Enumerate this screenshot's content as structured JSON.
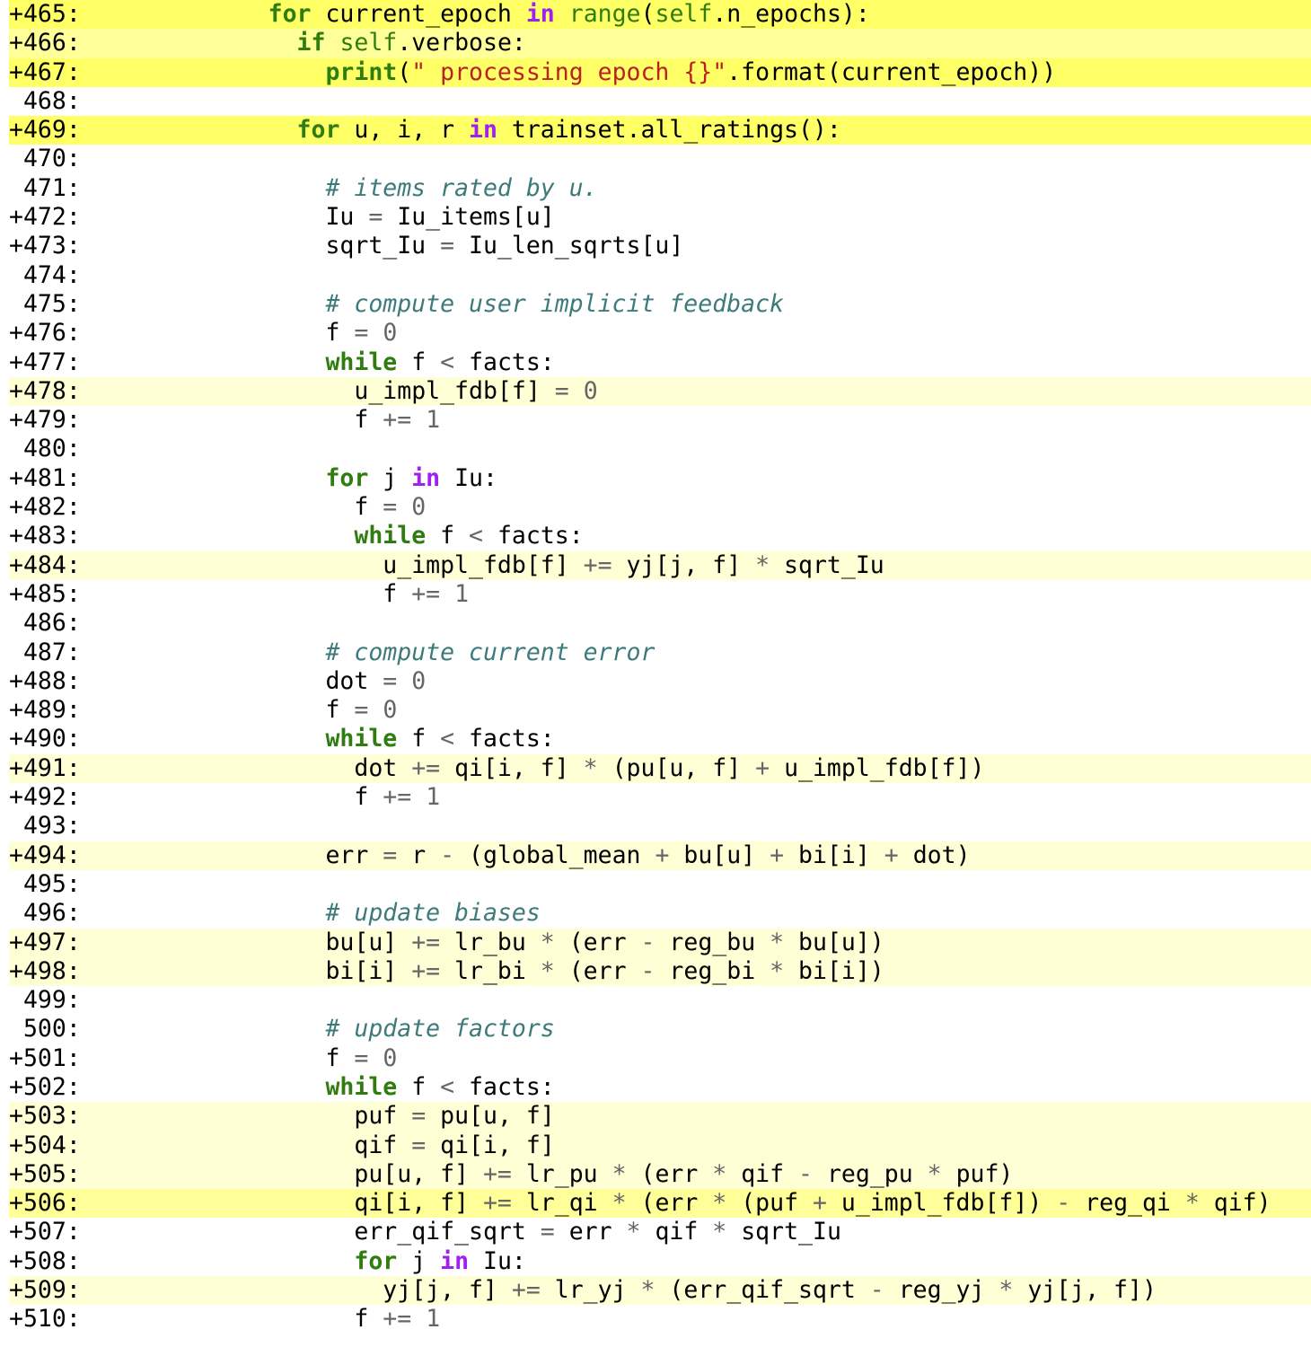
{
  "lines": [
    {
      "no": "+465:",
      "hl": 3,
      "indent": 4,
      "toks": [
        [
          "for",
          "kw"
        ],
        [
          " current_epoch ",
          ""
        ],
        [
          "in",
          "kwp"
        ],
        [
          " ",
          ""
        ],
        [
          "range",
          "bi"
        ],
        [
          "(",
          ""
        ],
        [
          "self",
          "bi"
        ],
        [
          ".n_epochs):",
          ""
        ]
      ]
    },
    {
      "no": "+466:",
      "hl": 2,
      "indent": 5,
      "toks": [
        [
          "if",
          "kw"
        ],
        [
          " ",
          ""
        ],
        [
          "self",
          "bi"
        ],
        [
          ".verbose:",
          ""
        ]
      ]
    },
    {
      "no": "+467:",
      "hl": 3,
      "indent": 6,
      "toks": [
        [
          "print",
          "kw"
        ],
        [
          "(",
          ""
        ],
        [
          "\" processing epoch {}\"",
          "str"
        ],
        [
          ".format(current_epoch))",
          ""
        ]
      ]
    },
    {
      "no": " 468:",
      "hl": 0,
      "indent": 0,
      "toks": []
    },
    {
      "no": "+469:",
      "hl": 3,
      "indent": 5,
      "toks": [
        [
          "for",
          "kw"
        ],
        [
          " u, i, r ",
          ""
        ],
        [
          "in",
          "kwp"
        ],
        [
          " trainset.all_ratings():",
          ""
        ]
      ]
    },
    {
      "no": " 470:",
      "hl": 0,
      "indent": 0,
      "toks": []
    },
    {
      "no": " 471:",
      "hl": 0,
      "indent": 6,
      "toks": [
        [
          "# items rated by u.",
          "cm"
        ]
      ]
    },
    {
      "no": "+472:",
      "hl": 0,
      "indent": 6,
      "toks": [
        [
          "Iu ",
          ""
        ],
        [
          "=",
          "op"
        ],
        [
          " Iu_items[u]",
          ""
        ]
      ]
    },
    {
      "no": "+473:",
      "hl": 0,
      "indent": 6,
      "toks": [
        [
          "sqrt_Iu ",
          ""
        ],
        [
          "=",
          "op"
        ],
        [
          " Iu_len_sqrts[u]",
          ""
        ]
      ]
    },
    {
      "no": " 474:",
      "hl": 0,
      "indent": 0,
      "toks": []
    },
    {
      "no": " 475:",
      "hl": 0,
      "indent": 6,
      "toks": [
        [
          "# compute user implicit feedback",
          "cm"
        ]
      ]
    },
    {
      "no": "+476:",
      "hl": 0,
      "indent": 6,
      "toks": [
        [
          "f ",
          ""
        ],
        [
          "=",
          "op"
        ],
        [
          " ",
          ""
        ],
        [
          "0",
          "num"
        ]
      ]
    },
    {
      "no": "+477:",
      "hl": 0,
      "indent": 6,
      "toks": [
        [
          "while",
          "kw"
        ],
        [
          " f ",
          ""
        ],
        [
          "<",
          "op"
        ],
        [
          " facts:",
          ""
        ]
      ]
    },
    {
      "no": "+478:",
      "hl": 1,
      "indent": 7,
      "toks": [
        [
          "u_impl_fdb[f] ",
          ""
        ],
        [
          "=",
          "op"
        ],
        [
          " ",
          ""
        ],
        [
          "0",
          "num"
        ]
      ]
    },
    {
      "no": "+479:",
      "hl": 0,
      "indent": 7,
      "toks": [
        [
          "f ",
          ""
        ],
        [
          "+=",
          "op"
        ],
        [
          " ",
          ""
        ],
        [
          "1",
          "num"
        ]
      ]
    },
    {
      "no": " 480:",
      "hl": 0,
      "indent": 0,
      "toks": []
    },
    {
      "no": "+481:",
      "hl": 0,
      "indent": 6,
      "toks": [
        [
          "for",
          "kw"
        ],
        [
          " j ",
          ""
        ],
        [
          "in",
          "kwp"
        ],
        [
          " Iu:",
          ""
        ]
      ]
    },
    {
      "no": "+482:",
      "hl": 0,
      "indent": 7,
      "toks": [
        [
          "f ",
          ""
        ],
        [
          "=",
          "op"
        ],
        [
          " ",
          ""
        ],
        [
          "0",
          "num"
        ]
      ]
    },
    {
      "no": "+483:",
      "hl": 0,
      "indent": 7,
      "toks": [
        [
          "while",
          "kw"
        ],
        [
          " f ",
          ""
        ],
        [
          "<",
          "op"
        ],
        [
          " facts:",
          ""
        ]
      ]
    },
    {
      "no": "+484:",
      "hl": 1,
      "indent": 8,
      "toks": [
        [
          "u_impl_fdb[f] ",
          ""
        ],
        [
          "+=",
          "op"
        ],
        [
          " yj[j, f] ",
          ""
        ],
        [
          "*",
          "op"
        ],
        [
          " sqrt_Iu",
          ""
        ]
      ]
    },
    {
      "no": "+485:",
      "hl": 0,
      "indent": 8,
      "toks": [
        [
          "f ",
          ""
        ],
        [
          "+=",
          "op"
        ],
        [
          " ",
          ""
        ],
        [
          "1",
          "num"
        ]
      ]
    },
    {
      "no": " 486:",
      "hl": 0,
      "indent": 0,
      "toks": []
    },
    {
      "no": " 487:",
      "hl": 0,
      "indent": 6,
      "toks": [
        [
          "# compute current error",
          "cm"
        ]
      ]
    },
    {
      "no": "+488:",
      "hl": 0,
      "indent": 6,
      "toks": [
        [
          "dot ",
          ""
        ],
        [
          "=",
          "op"
        ],
        [
          " ",
          ""
        ],
        [
          "0",
          "num"
        ]
      ]
    },
    {
      "no": "+489:",
      "hl": 0,
      "indent": 6,
      "toks": [
        [
          "f ",
          ""
        ],
        [
          "=",
          "op"
        ],
        [
          " ",
          ""
        ],
        [
          "0",
          "num"
        ]
      ]
    },
    {
      "no": "+490:",
      "hl": 0,
      "indent": 6,
      "toks": [
        [
          "while",
          "kw"
        ],
        [
          " f ",
          ""
        ],
        [
          "<",
          "op"
        ],
        [
          " facts:",
          ""
        ]
      ]
    },
    {
      "no": "+491:",
      "hl": 1,
      "indent": 7,
      "toks": [
        [
          "dot ",
          ""
        ],
        [
          "+=",
          "op"
        ],
        [
          " qi[i, f] ",
          ""
        ],
        [
          "*",
          "op"
        ],
        [
          " (pu[u, f] ",
          ""
        ],
        [
          "+",
          "op"
        ],
        [
          " u_impl_fdb[f])",
          ""
        ]
      ]
    },
    {
      "no": "+492:",
      "hl": 0,
      "indent": 7,
      "toks": [
        [
          "f ",
          ""
        ],
        [
          "+=",
          "op"
        ],
        [
          " ",
          ""
        ],
        [
          "1",
          "num"
        ]
      ]
    },
    {
      "no": " 493:",
      "hl": 0,
      "indent": 0,
      "toks": []
    },
    {
      "no": "+494:",
      "hl": 1,
      "indent": 6,
      "toks": [
        [
          "err ",
          ""
        ],
        [
          "=",
          "op"
        ],
        [
          " r ",
          ""
        ],
        [
          "-",
          "op"
        ],
        [
          " (global_mean ",
          ""
        ],
        [
          "+",
          "op"
        ],
        [
          " bu[u] ",
          ""
        ],
        [
          "+",
          "op"
        ],
        [
          " bi[i] ",
          ""
        ],
        [
          "+",
          "op"
        ],
        [
          " dot)",
          ""
        ]
      ]
    },
    {
      "no": " 495:",
      "hl": 0,
      "indent": 0,
      "toks": []
    },
    {
      "no": " 496:",
      "hl": 0,
      "indent": 6,
      "toks": [
        [
          "# update biases",
          "cm"
        ]
      ]
    },
    {
      "no": "+497:",
      "hl": 1,
      "indent": 6,
      "toks": [
        [
          "bu[u] ",
          ""
        ],
        [
          "+=",
          "op"
        ],
        [
          " lr_bu ",
          ""
        ],
        [
          "*",
          "op"
        ],
        [
          " (err ",
          ""
        ],
        [
          "-",
          "op"
        ],
        [
          " reg_bu ",
          ""
        ],
        [
          "*",
          "op"
        ],
        [
          " bu[u])",
          ""
        ]
      ]
    },
    {
      "no": "+498:",
      "hl": 1,
      "indent": 6,
      "toks": [
        [
          "bi[i] ",
          ""
        ],
        [
          "+=",
          "op"
        ],
        [
          " lr_bi ",
          ""
        ],
        [
          "*",
          "op"
        ],
        [
          " (err ",
          ""
        ],
        [
          "-",
          "op"
        ],
        [
          " reg_bi ",
          ""
        ],
        [
          "*",
          "op"
        ],
        [
          " bi[i])",
          ""
        ]
      ]
    },
    {
      "no": " 499:",
      "hl": 0,
      "indent": 0,
      "toks": []
    },
    {
      "no": " 500:",
      "hl": 0,
      "indent": 6,
      "toks": [
        [
          "# update factors",
          "cm"
        ]
      ]
    },
    {
      "no": "+501:",
      "hl": 0,
      "indent": 6,
      "toks": [
        [
          "f ",
          ""
        ],
        [
          "=",
          "op"
        ],
        [
          " ",
          ""
        ],
        [
          "0",
          "num"
        ]
      ]
    },
    {
      "no": "+502:",
      "hl": 0,
      "indent": 6,
      "toks": [
        [
          "while",
          "kw"
        ],
        [
          " f ",
          ""
        ],
        [
          "<",
          "op"
        ],
        [
          " facts:",
          ""
        ]
      ]
    },
    {
      "no": "+503:",
      "hl": 1,
      "indent": 7,
      "toks": [
        [
          "puf ",
          ""
        ],
        [
          "=",
          "op"
        ],
        [
          " pu[u, f]",
          ""
        ]
      ]
    },
    {
      "no": "+504:",
      "hl": 1,
      "indent": 7,
      "toks": [
        [
          "qif ",
          ""
        ],
        [
          "=",
          "op"
        ],
        [
          " qi[i, f]",
          ""
        ]
      ]
    },
    {
      "no": "+505:",
      "hl": 1,
      "indent": 7,
      "toks": [
        [
          "pu[u, f] ",
          ""
        ],
        [
          "+=",
          "op"
        ],
        [
          " lr_pu ",
          ""
        ],
        [
          "*",
          "op"
        ],
        [
          " (err ",
          ""
        ],
        [
          "*",
          "op"
        ],
        [
          " qif ",
          ""
        ],
        [
          "-",
          "op"
        ],
        [
          " reg_pu ",
          ""
        ],
        [
          "*",
          "op"
        ],
        [
          " puf)",
          ""
        ]
      ]
    },
    {
      "no": "+506:",
      "hl": 2,
      "indent": 7,
      "toks": [
        [
          "qi[i, f] ",
          ""
        ],
        [
          "+=",
          "op"
        ],
        [
          " lr_qi ",
          ""
        ],
        [
          "*",
          "op"
        ],
        [
          " (err ",
          ""
        ],
        [
          "*",
          "op"
        ],
        [
          " (puf ",
          ""
        ],
        [
          "+",
          "op"
        ],
        [
          " u_impl_fdb[f]) ",
          ""
        ],
        [
          "-",
          "op"
        ],
        [
          " reg_qi ",
          ""
        ],
        [
          "*",
          "op"
        ],
        [
          " qif)",
          ""
        ]
      ]
    },
    {
      "no": "+507:",
      "hl": 0,
      "indent": 7,
      "toks": [
        [
          "err_qif_sqrt ",
          ""
        ],
        [
          "=",
          "op"
        ],
        [
          " err ",
          ""
        ],
        [
          "*",
          "op"
        ],
        [
          " qif ",
          ""
        ],
        [
          "*",
          "op"
        ],
        [
          " sqrt_Iu",
          ""
        ]
      ]
    },
    {
      "no": "+508:",
      "hl": 0,
      "indent": 7,
      "toks": [
        [
          "for",
          "kw"
        ],
        [
          " j ",
          ""
        ],
        [
          "in",
          "kwp"
        ],
        [
          " Iu:",
          ""
        ]
      ]
    },
    {
      "no": "+509:",
      "hl": 1,
      "indent": 8,
      "toks": [
        [
          "yj[j, f] ",
          ""
        ],
        [
          "+=",
          "op"
        ],
        [
          " lr_yj ",
          ""
        ],
        [
          "*",
          "op"
        ],
        [
          " (err_qif_sqrt ",
          ""
        ],
        [
          "-",
          "op"
        ],
        [
          " reg_yj ",
          ""
        ],
        [
          "*",
          "op"
        ],
        [
          " yj[j, f])",
          ""
        ]
      ]
    },
    {
      "no": "+510:",
      "hl": 0,
      "indent": 7,
      "toks": [
        [
          "f ",
          ""
        ],
        [
          "+=",
          "op"
        ],
        [
          " ",
          ""
        ],
        [
          "1",
          "num"
        ]
      ]
    }
  ]
}
